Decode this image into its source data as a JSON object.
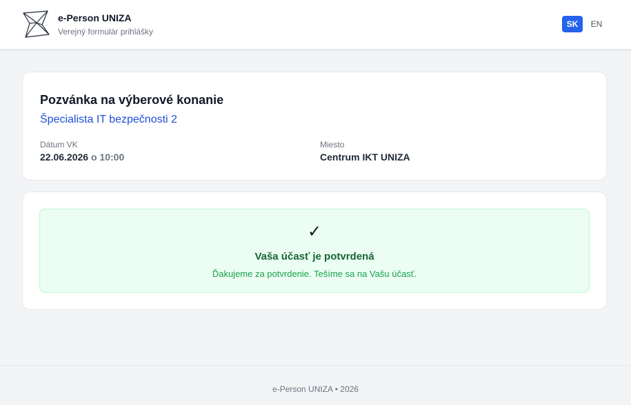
{
  "header": {
    "logo_icon": "uniza-logo-icon",
    "brand_title": "e-Person UNIZA",
    "brand_subtitle": "Verejný formulár prihlášky",
    "languages": [
      {
        "code": "SK",
        "active": true
      },
      {
        "code": "EN",
        "active": false
      }
    ],
    "accent_color": "#2563eb"
  },
  "invitation": {
    "title": "Pozvánka na výberové konanie",
    "position": "Špecialista IT bezpečnosti 2",
    "date_label": "Dátum VK",
    "date_value": "22.06.2026",
    "time_separator": "o",
    "time_value": "10:00",
    "place_label": "Miesto",
    "place_value": "Centrum IKT UNIZA"
  },
  "confirmation": {
    "icon": "checkmark-icon",
    "icon_glyph": "✓",
    "title": "Vaša účasť je potvrdená",
    "message": "Ďakujeme za potvrdenie. Tešíme sa na Vašu účasť.",
    "status_color": "#16a34a"
  },
  "footer": {
    "text": "e-Person UNIZA • 2026"
  }
}
